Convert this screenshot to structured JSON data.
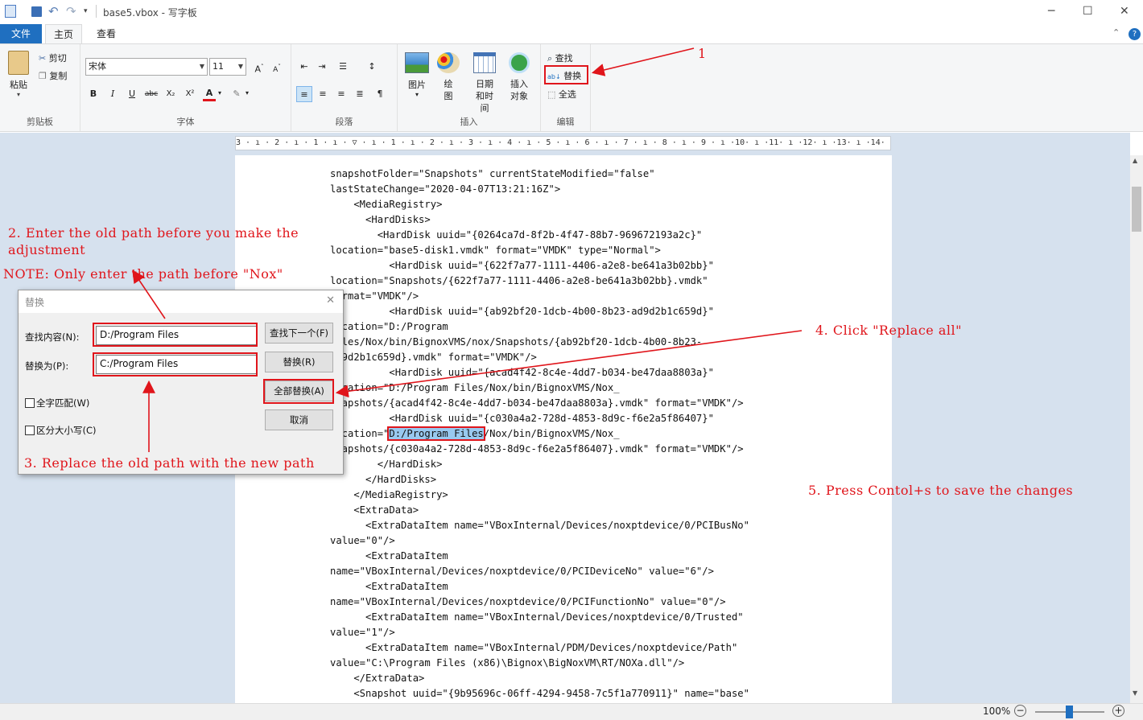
{
  "window": {
    "title": "base5.vbox - 写字板",
    "controls": [
      "─",
      "☐",
      "✕"
    ]
  },
  "tabs": {
    "file": "文件",
    "home": "主页",
    "view": "查看"
  },
  "ribbon": {
    "clipboard": {
      "label": "剪贴板",
      "paste": "粘贴",
      "cut": "剪切",
      "copy": "复制"
    },
    "font": {
      "label": "字体",
      "name": "宋体",
      "size": "11"
    },
    "paragraph": {
      "label": "段落"
    },
    "insert": {
      "label": "插入",
      "picture": "图片",
      "paint": "绘图",
      "datetime": "日期和时间",
      "object": "插入对象"
    },
    "edit": {
      "label": "编辑",
      "find": "查找",
      "replace": "替换",
      "select_all": "全选"
    }
  },
  "ruler": "3 · ı · 2 · ı · 1 · ı · ▽ · ı · 1 · ı · 2 · ı · 3 · ı · 4 · ı · 5 · ı · 6 · ı · 7 · ı · 8 · ı · 9 · ı ·10· ı ·11· ı ·12· ı ·13· ı ·14· ı ·15· ı ·16· ı ·17· ı ·18·",
  "document": {
    "lines": [
      "snapshotFolder=\"Snapshots\" currentStateModified=\"false\"",
      "lastStateChange=\"2020-04-07T13:21:16Z\">",
      "    <MediaRegistry>",
      "      <HardDisks>",
      "        <HardDisk uuid=\"{0264ca7d-8f2b-4f47-88b7-969672193a2c}\"",
      "location=\"base5-disk1.vmdk\" format=\"VMDK\" type=\"Normal\">",
      "          <HardDisk uuid=\"{622f7a77-1111-4406-a2e8-be641a3b02bb}\"",
      "location=\"Snapshots/{622f7a77-1111-4406-a2e8-be641a3b02bb}.vmdk\"",
      "format=\"VMDK\"/>",
      "          <HardDisk uuid=\"{ab92bf20-1dcb-4b00-8b23-ad9d2b1c659d}\"",
      "location=\"D:/Program",
      "Files/Nox/bin/BignoxVMS/nox/Snapshots/{ab92bf20-1dcb-4b00-8b23-",
      "ad9d2b1c659d}.vmdk\" format=\"VMDK\"/>",
      "          <HardDisk uuid=\"{acad4f42-8c4e-4dd7-b034-be47daa8803a}\"",
      "location=\"D:/Program Files/Nox/bin/BignoxVMS/Nox_",
      "Snapshots/{acad4f42-8c4e-4dd7-b034-be47daa8803a}.vmdk\" format=\"VMDK\"/>",
      "          <HardDisk uuid=\"{c030a4a2-728d-4853-8d9c-f6e2a5f86407}\""
    ],
    "hl_prefix": "location=\"",
    "hl_text": "D:/Program Files",
    "hl_suffix": "/Nox/bin/BignoxVMS/Nox_",
    "lines2": [
      "Snapshots/{c030a4a2-728d-4853-8d9c-f6e2a5f86407}.vmdk\" format=\"VMDK\"/>",
      "        </HardDisk>",
      "      </HardDisks>",
      "    </MediaRegistry>",
      "    <ExtraData>",
      "      <ExtraDataItem name=\"VBoxInternal/Devices/noxptdevice/0/PCIBusNo\"",
      "value=\"0\"/>",
      "      <ExtraDataItem",
      "name=\"VBoxInternal/Devices/noxptdevice/0/PCIDeviceNo\" value=\"6\"/>",
      "      <ExtraDataItem",
      "name=\"VBoxInternal/Devices/noxptdevice/0/PCIFunctionNo\" value=\"0\"/>",
      "      <ExtraDataItem name=\"VBoxInternal/Devices/noxptdevice/0/Trusted\"",
      "value=\"1\"/>",
      "      <ExtraDataItem name=\"VBoxInternal/PDM/Devices/noxptdevice/Path\"",
      "value=\"C:\\Program Files (x86)\\Bignox\\BigNoxVM\\RT/NOXa.dll\"/>",
      "    </ExtraData>",
      "    <Snapshot uuid=\"{9b95696c-06ff-4294-9458-7c5f1a770911}\" name=\"base\""
    ]
  },
  "dialog": {
    "title": "替换",
    "find_label": "查找内容(N):",
    "find_value": "D:/Program Files",
    "replace_label": "替换为(P):",
    "replace_value": "C:/Program Files",
    "find_next": "查找下一个(F)",
    "replace": "替换(R)",
    "replace_all": "全部替换(A)",
    "cancel": "取消",
    "whole_word": "全字匹配(W)",
    "match_case": "区分大小写(C)"
  },
  "annotations": {
    "a1": "1",
    "a2a": "2. Enter the old path before you make the",
    "a2b": "adjustment",
    "note": "NOTE: Only enter the path before \"Nox\"",
    "a3": "3. Replace the old path with the new path",
    "a4": "4. Click \"Replace all\"",
    "a5": "5. Press Contol+s to save the changes"
  },
  "status": {
    "zoom": "100%"
  },
  "colors": {
    "accent": "#1f6fc0",
    "annotation": "#e0151b",
    "highlight": "#99c9ef"
  }
}
